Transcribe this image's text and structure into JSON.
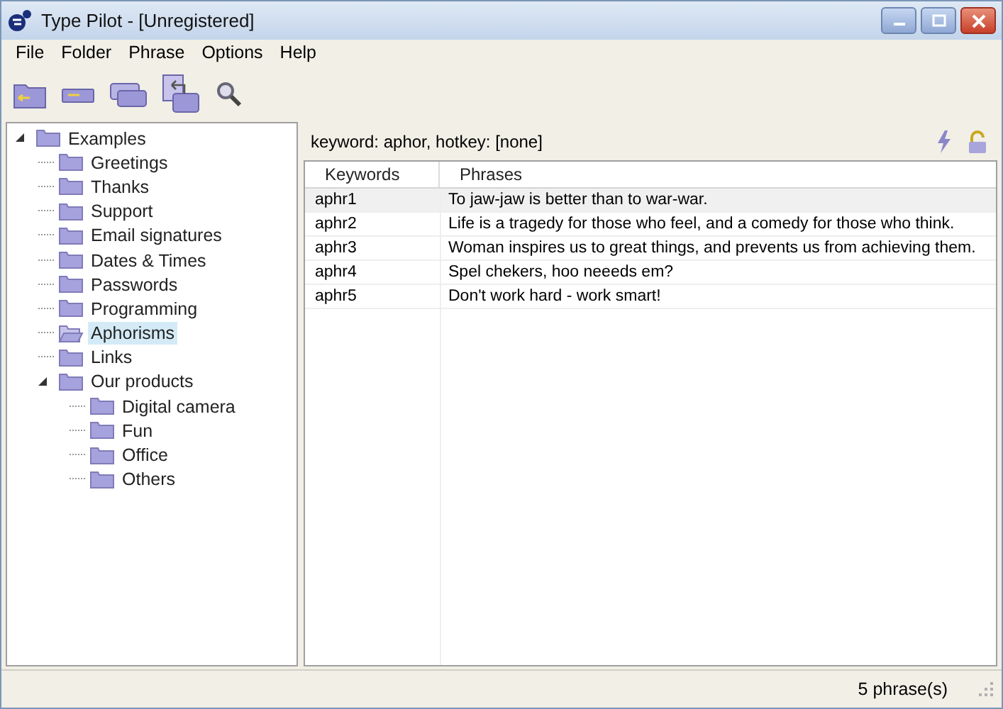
{
  "window": {
    "title": "Type Pilot - [Unregistered]"
  },
  "menu": [
    "File",
    "Folder",
    "Phrase",
    "Options",
    "Help"
  ],
  "toolbar": [
    {
      "kind": "folder"
    },
    {
      "kind": "bar"
    },
    {
      "kind": "stack"
    },
    {
      "kind": "copy"
    },
    {
      "kind": "search"
    }
  ],
  "tree": [
    {
      "label": "Examples",
      "expanded": true,
      "selected": false,
      "children": [
        {
          "label": "Greetings",
          "selected": false
        },
        {
          "label": "Thanks",
          "selected": false
        },
        {
          "label": "Support",
          "selected": false
        },
        {
          "label": "Email signatures",
          "selected": false
        },
        {
          "label": "Dates & Times",
          "selected": false
        },
        {
          "label": "Passwords",
          "selected": false
        },
        {
          "label": "Programming",
          "selected": false
        },
        {
          "label": "Aphorisms",
          "selected": true
        },
        {
          "label": "Links",
          "selected": false
        },
        {
          "label": "Our products",
          "expanded": true,
          "selected": false,
          "children": [
            {
              "label": "Digital camera",
              "selected": false
            },
            {
              "label": "Fun",
              "selected": false
            },
            {
              "label": "Office",
              "selected": false
            },
            {
              "label": "Others",
              "selected": false
            }
          ]
        }
      ]
    }
  ],
  "info": "keyword: aphor,  hotkey: [none]",
  "table": {
    "columns": [
      "Keywords",
      "Phrases"
    ],
    "rows": [
      {
        "cells": [
          "aphr1",
          "To jaw-jaw is better than to war-war."
        ],
        "selected": true
      },
      {
        "cells": [
          "aphr2",
          "Life is a tragedy for those who feel, and a comedy for those who think."
        ],
        "selected": false
      },
      {
        "cells": [
          "aphr3",
          "Woman inspires us to great things, and prevents us from achieving them."
        ],
        "selected": false
      },
      {
        "cells": [
          "aphr4",
          "Spel chekers, hoo neeeds em?"
        ],
        "selected": false
      },
      {
        "cells": [
          "aphr5",
          "Don't work hard - work smart!"
        ],
        "selected": false
      }
    ]
  },
  "status_bar": "5 phrase(s)"
}
